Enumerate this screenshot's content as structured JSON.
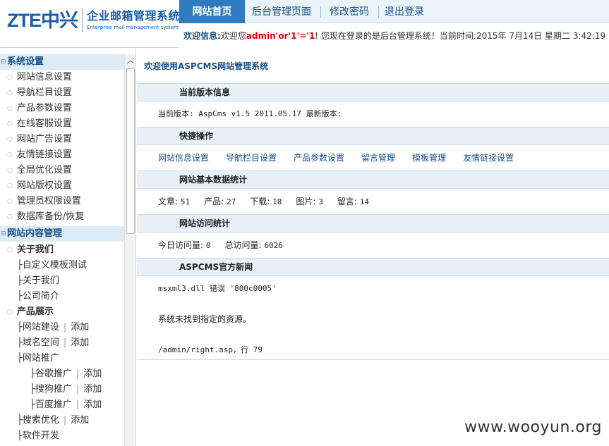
{
  "header": {
    "logo_brand": "ZTE中兴",
    "logo_title": "企业邮箱管理系统",
    "logo_subtitle": "Enterprise mail management system",
    "tabs": [
      {
        "label": "网站首页",
        "active": true
      },
      {
        "label": "后台管理页面"
      },
      {
        "label": "修改密码"
      },
      {
        "label": "退出登录"
      }
    ],
    "welcome_label": "欢迎信息:",
    "welcome_prefix": "欢迎您",
    "welcome_user": "admin'or'1'='1",
    "welcome_suffix": "! 您现在登录的是后台管理系统！当前时间:2015年 7月14日 星期二 3:42:19"
  },
  "sidebar": {
    "sections": [
      {
        "title": "系统设置",
        "mark": "⊟"
      },
      {
        "title": "网站内容管理",
        "mark": "⊟"
      }
    ],
    "system_items": [
      "网站信息设置",
      "导航栏目设置",
      "产品参数设置",
      "在线客服设置",
      "网站广告设置",
      "友情链接设置",
      "全局优化设置",
      "网站版权设置",
      "管理员权限设置",
      "数据库备份/恢复"
    ],
    "content": {
      "about": "关于我们",
      "about_children": [
        "├自定义模板测试",
        "├关于我们",
        "├公司简介"
      ],
      "products": "产品展示",
      "products_children": [
        {
          "label": "├网站建设",
          "add": "添加"
        },
        {
          "label": "├域名空间",
          "add": "添加"
        },
        {
          "label": "├网站推广",
          "add": ""
        }
      ],
      "promo_children": [
        {
          "label": "├谷歌推广",
          "add": "添加"
        },
        {
          "label": "├搜狗推广",
          "add": "添加"
        },
        {
          "label": "├百度推广",
          "add": "添加"
        }
      ],
      "tail_children": [
        {
          "label": "├搜索优化",
          "add": "添加"
        },
        {
          "label": "├软件开发",
          "add": ""
        }
      ]
    },
    "pipe": "|"
  },
  "main": {
    "title": "欢迎使用ASPCMS网站管理系统",
    "version": {
      "heading": "当前版本信息",
      "text": "当前版本: AspCms v1.5 2011.05.17 最新版本:"
    },
    "quick": {
      "heading": "快捷操作",
      "links": [
        "网站信息设置",
        "导航栏目设置",
        "产品参数设置",
        "留言管理",
        "模板管理",
        "友情链接设置"
      ]
    },
    "stats": {
      "heading": "网站基本数据统计",
      "items": [
        {
          "label": "文章:",
          "value": "51"
        },
        {
          "label": "产品:",
          "value": "27"
        },
        {
          "label": "下载:",
          "value": "18"
        },
        {
          "label": "图片:",
          "value": "3"
        },
        {
          "label": "留言:",
          "value": "14"
        }
      ]
    },
    "visits": {
      "heading": "网站访问统计",
      "today_label": "今日访问量:",
      "today_value": "0",
      "total_label": "总访问量:",
      "total_value": "6026"
    },
    "news": {
      "heading": "ASPCMS官方新闻",
      "error_line1": "msxml3.dll 错误 '800c0005'",
      "error_line2": "系统未找到指定的资源。",
      "error_line3": "/admin/right.asp，行 79"
    }
  },
  "watermark": "www.wooyun.org",
  "scroll_up_glyph": "︿"
}
